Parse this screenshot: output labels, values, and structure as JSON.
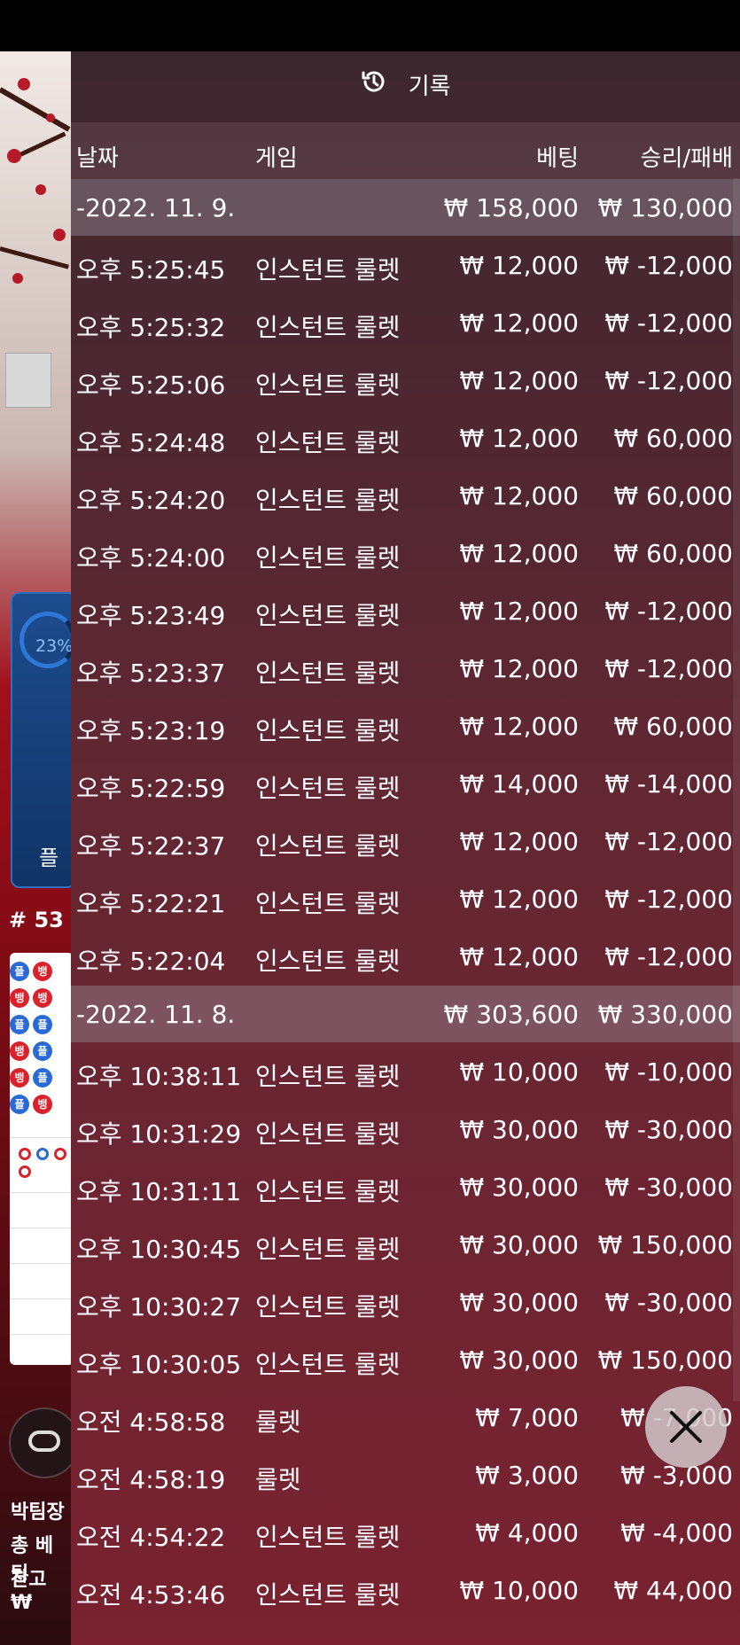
{
  "background": {
    "progress_percent": "23%",
    "card_label": "플",
    "round_label": "# 53",
    "bottom_lines": [
      "박팀장",
      "총 베팅",
      "잔고 ₩"
    ]
  },
  "panel": {
    "title": "기록",
    "columns": {
      "date": "날짜",
      "game": "게임",
      "bet": "베팅",
      "result": "승리/패배"
    }
  },
  "groups": [
    {
      "date": "-2022. 11. 9.",
      "total_bet": "₩ 158,000",
      "total_result": "₩ 130,000",
      "rows": [
        {
          "time": "오후 5:25:45",
          "game": "인스턴트 룰렛",
          "bet": "₩ 12,000",
          "result": "₩ -12,000"
        },
        {
          "time": "오후 5:25:32",
          "game": "인스턴트 룰렛",
          "bet": "₩ 12,000",
          "result": "₩ -12,000"
        },
        {
          "time": "오후 5:25:06",
          "game": "인스턴트 룰렛",
          "bet": "₩ 12,000",
          "result": "₩ -12,000"
        },
        {
          "time": "오후 5:24:48",
          "game": "인스턴트 룰렛",
          "bet": "₩ 12,000",
          "result": "₩ 60,000"
        },
        {
          "time": "오후 5:24:20",
          "game": "인스턴트 룰렛",
          "bet": "₩ 12,000",
          "result": "₩ 60,000"
        },
        {
          "time": "오후 5:24:00",
          "game": "인스턴트 룰렛",
          "bet": "₩ 12,000",
          "result": "₩ 60,000"
        },
        {
          "time": "오후 5:23:49",
          "game": "인스턴트 룰렛",
          "bet": "₩ 12,000",
          "result": "₩ -12,000"
        },
        {
          "time": "오후 5:23:37",
          "game": "인스턴트 룰렛",
          "bet": "₩ 12,000",
          "result": "₩ -12,000"
        },
        {
          "time": "오후 5:23:19",
          "game": "인스턴트 룰렛",
          "bet": "₩ 12,000",
          "result": "₩ 60,000"
        },
        {
          "time": "오후 5:22:59",
          "game": "인스턴트 룰렛",
          "bet": "₩ 14,000",
          "result": "₩ -14,000"
        },
        {
          "time": "오후 5:22:37",
          "game": "인스턴트 룰렛",
          "bet": "₩ 12,000",
          "result": "₩ -12,000"
        },
        {
          "time": "오후 5:22:21",
          "game": "인스턴트 룰렛",
          "bet": "₩ 12,000",
          "result": "₩ -12,000"
        },
        {
          "time": "오후 5:22:04",
          "game": "인스턴트 룰렛",
          "bet": "₩ 12,000",
          "result": "₩ -12,000"
        }
      ]
    },
    {
      "date": "-2022. 11. 8.",
      "total_bet": "₩ 303,600",
      "total_result": "₩ 330,000",
      "rows": [
        {
          "time": "오후 10:38:11",
          "game": "인스턴트 룰렛",
          "bet": "₩ 10,000",
          "result": "₩ -10,000"
        },
        {
          "time": "오후 10:31:29",
          "game": "인스턴트 룰렛",
          "bet": "₩ 30,000",
          "result": "₩ -30,000"
        },
        {
          "time": "오후 10:31:11",
          "game": "인스턴트 룰렛",
          "bet": "₩ 30,000",
          "result": "₩ -30,000"
        },
        {
          "time": "오후 10:30:45",
          "game": "인스턴트 룰렛",
          "bet": "₩ 30,000",
          "result": "₩ 150,000"
        },
        {
          "time": "오후 10:30:27",
          "game": "인스턴트 룰렛",
          "bet": "₩ 30,000",
          "result": "₩ -30,000"
        },
        {
          "time": "오후 10:30:05",
          "game": "인스턴트 룰렛",
          "bet": "₩ 30,000",
          "result": "₩ 150,000"
        },
        {
          "time": "오전 4:58:58",
          "game": "룰렛",
          "bet": "₩ 7,000",
          "result": "₩ -7,000"
        },
        {
          "time": "오전 4:58:19",
          "game": "룰렛",
          "bet": "₩ 3,000",
          "result": "₩ -3,000"
        },
        {
          "time": "오전 4:54:22",
          "game": "인스턴트 룰렛",
          "bet": "₩ 4,000",
          "result": "₩ -4,000"
        },
        {
          "time": "오전 4:53:46",
          "game": "인스턴트 룰렛",
          "bet": "₩ 10,000",
          "result": "₩ 44,000"
        }
      ]
    }
  ]
}
